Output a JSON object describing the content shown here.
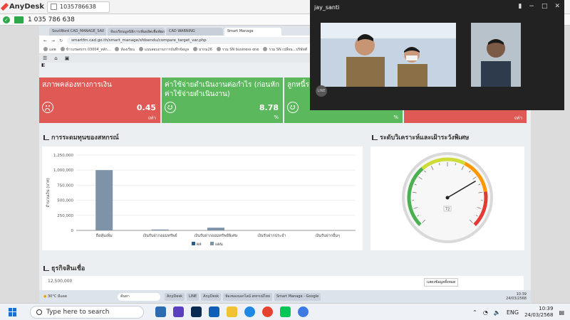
{
  "anydesk": {
    "app_name": "AnyDesk",
    "tab_id": "1035786638",
    "session_id": "1 035 786 638"
  },
  "browser": {
    "tabs": [
      "SoutWord CAD_MANAGE_SAV",
      "ห้องเรียนมูลนิธิการเพิ่มผลิตเพื่อพัฒนา",
      "CAD WARNING",
      "Smart Manage"
    ],
    "url": "smartfm.cad.go.th/smart_manage/sfdsendu/compare_target_var.php",
    "bookmarks": [
      "แอพ",
      "ข้าวเกษตรกร 03004_หลัก...",
      "ห้องเรียน",
      "แบบสอบถามการบันทึกข้อมูล",
      "มากม26",
      "รวม SN business one",
      "รวม SN เปลี่ยน...บริษัทดี"
    ]
  },
  "cards": [
    {
      "title": "สภาพคล่องทางการเงิน",
      "value": "0.45",
      "unit": "เท่า",
      "mood": "sad"
    },
    {
      "title": "ค่าใช้จ่ายดำเนินงานต่อกำไร (ก่อนหักค่าใช้จ่ายดำเนินงาน)",
      "value": "8.78",
      "unit": "%",
      "mood": "happy"
    },
    {
      "title": "ลูกหนี้ระ...",
      "value": "",
      "unit": "%",
      "mood": "happy"
    },
    {
      "title": "",
      "value": "",
      "unit": "เท่า",
      "mood": "sad"
    }
  ],
  "capital_panel": {
    "title": "การระดมทุนของสหกรณ์"
  },
  "risk_panel": {
    "title": "ระดับวิเคราะห์และเฝ้าระวังพิเศษ"
  },
  "credit_panel": {
    "title": "ธุรกิจสินเชื่อ",
    "button": "แสดงข้อมูลทั้งหมด",
    "y_top": "12,500,000"
  },
  "chart_data": [
    {
      "type": "bar",
      "title": "การระดมทุนของสหกรณ์",
      "ylabel": "จำนวนเงิน (บาท)",
      "categories": [
        "ถือหุ้นเพิ่ม",
        "เงินรับฝากออมทรัพย์",
        "เงินรับฝากออมทรัพย์พิเศษ",
        "เงินรับฝากประจำ",
        "เงินรับฝากอื่นๆ"
      ],
      "ylim": [
        0,
        1250000
      ],
      "yticks": [
        "0",
        "250,000",
        "500,000",
        "750,000",
        "1,000,000",
        "1,250,000"
      ],
      "series": [
        {
          "name": "ผล",
          "values": [
            0,
            0,
            0,
            0,
            0
          ],
          "color": "#2b5b8f"
        },
        {
          "name": "แผน",
          "values": [
            1000000,
            15000,
            45000,
            0,
            0
          ],
          "color": "#7f93a8"
        }
      ]
    },
    {
      "type": "gauge",
      "value": 72,
      "value_label": "72",
      "range": [
        0,
        100
      ]
    }
  ],
  "video": {
    "user": "jay_santi",
    "badge": "LINE"
  },
  "remote_taskbar": {
    "weather_temp": "30°C",
    "weather_text": "มีแดด",
    "search": "ค้นหา",
    "apps": [
      "AnyDesk",
      "LINE",
      "AnyDesk",
      "ห้องของบอกไลน์ สหกรณ์ไทย",
      "Smart Manage - Google"
    ],
    "lang": "ENG",
    "time": "10:39",
    "date": "24/03/2568"
  },
  "taskbar": {
    "search_placeholder": "Type here to search",
    "lang": "ENG",
    "time": "10:39",
    "date": "24/03/2568"
  }
}
